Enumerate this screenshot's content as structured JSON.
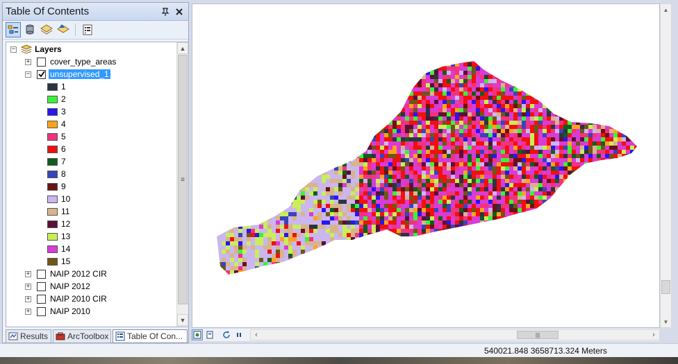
{
  "toc": {
    "title": "Table Of Contents",
    "pin_glyph": " ∖",
    "root_label": "Layers",
    "layers": [
      {
        "label": "cover_type_areas",
        "checked": false,
        "expanded": false,
        "selected": false
      },
      {
        "label": "unsupervised_1",
        "checked": true,
        "expanded": true,
        "selected": true
      },
      {
        "label": "NAIP 2012 CIR",
        "checked": false,
        "expanded": false,
        "selected": false
      },
      {
        "label": "NAIP 2012",
        "checked": false,
        "expanded": false,
        "selected": false
      },
      {
        "label": "NAIP 2010 CIR",
        "checked": false,
        "expanded": false,
        "selected": false
      },
      {
        "label": "NAIP 2010",
        "checked": false,
        "expanded": false,
        "selected": false
      }
    ],
    "classes": [
      {
        "label": "1",
        "color": "#2b3540"
      },
      {
        "label": "2",
        "color": "#39f33a"
      },
      {
        "label": "3",
        "color": "#2a16f0"
      },
      {
        "label": "4",
        "color": "#ffa31a"
      },
      {
        "label": "5",
        "color": "#f2327f"
      },
      {
        "label": "6",
        "color": "#f10f0f"
      },
      {
        "label": "7",
        "color": "#0f5e1e"
      },
      {
        "label": "8",
        "color": "#3845b8"
      },
      {
        "label": "9",
        "color": "#6b1212"
      },
      {
        "label": "10",
        "color": "#cbb6f0"
      },
      {
        "label": "11",
        "color": "#d8b48a"
      },
      {
        "label": "12",
        "color": "#5a0f3a"
      },
      {
        "label": "13",
        "color": "#c9ee58"
      },
      {
        "label": "14",
        "color": "#d93bd6"
      },
      {
        "label": "15",
        "color": "#6e5714"
      }
    ],
    "tabs": [
      {
        "label": "Results",
        "icon": "results-icon"
      },
      {
        "label": "ArcToolbox",
        "icon": "toolbox-icon"
      },
      {
        "label": "Table Of Con...",
        "icon": "table-of-contents-icon"
      }
    ]
  },
  "status": {
    "coordinates": "540021.848  3658713.324 Meters"
  }
}
